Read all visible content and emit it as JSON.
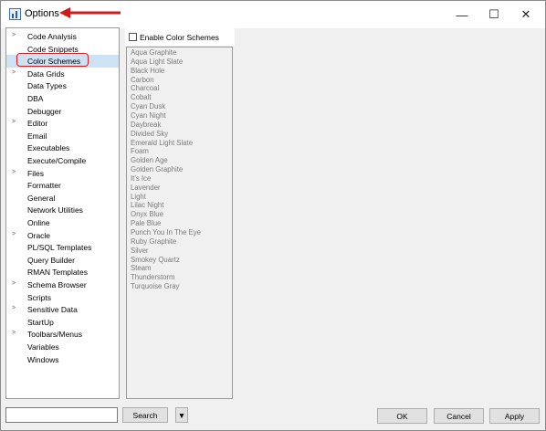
{
  "window": {
    "title": "Options",
    "minimize_glyph": "—",
    "maximize_glyph": "☐",
    "close_glyph": "✕",
    "annotation_color": "#d11a1a"
  },
  "tree": {
    "selected": "Color Schemes",
    "items": [
      {
        "label": "Code Analysis",
        "expandable": true
      },
      {
        "label": "Code Snippets",
        "expandable": false
      },
      {
        "label": "Color Schemes",
        "expandable": false
      },
      {
        "label": "Data Grids",
        "expandable": true
      },
      {
        "label": "Data Types",
        "expandable": false
      },
      {
        "label": "DBA",
        "expandable": false
      },
      {
        "label": "Debugger",
        "expandable": false
      },
      {
        "label": "Editor",
        "expandable": true
      },
      {
        "label": "Email",
        "expandable": false
      },
      {
        "label": "Executables",
        "expandable": false
      },
      {
        "label": "Execute/Compile",
        "expandable": false
      },
      {
        "label": "Files",
        "expandable": true
      },
      {
        "label": "Formatter",
        "expandable": false
      },
      {
        "label": "General",
        "expandable": false
      },
      {
        "label": "Network Utilities",
        "expandable": false
      },
      {
        "label": "Online",
        "expandable": false
      },
      {
        "label": "Oracle",
        "expandable": true
      },
      {
        "label": "PL/SQL Templates",
        "expandable": false
      },
      {
        "label": "Query Builder",
        "expandable": false
      },
      {
        "label": "RMAN Templates",
        "expandable": false
      },
      {
        "label": "Schema Browser",
        "expandable": true
      },
      {
        "label": "Scripts",
        "expandable": false
      },
      {
        "label": "Sensitive Data",
        "expandable": true
      },
      {
        "label": "StartUp",
        "expandable": false
      },
      {
        "label": "Toolbars/Menus",
        "expandable": true
      },
      {
        "label": "Variables",
        "expandable": false
      },
      {
        "label": "Windows",
        "expandable": false
      }
    ]
  },
  "color_schemes": {
    "enable_label": "Enable Color Schemes",
    "enabled": false,
    "schemes": [
      "Aqua Graphite",
      "Aqua Light Slate",
      "Black Hole",
      "Carbon",
      "Charcoal",
      "Cobalt",
      "Cyan Dusk",
      "Cyan Night",
      "Daybreak",
      "Divided Sky",
      "Emerald Light Slate",
      "Foam",
      "Golden Age",
      "Golden Graphite",
      "It's Ice",
      "Lavender",
      "Light",
      "Lilac Night",
      "Onyx Blue",
      "Pale Blue",
      "Punch You In The Eye",
      "Ruby Graphite",
      "Silver",
      "Smokey Quartz",
      "Steam",
      "Thunderstorm",
      "Turquoise Gray"
    ]
  },
  "footer": {
    "search_value": "",
    "search_label": "Search",
    "dropdown_glyph": "▼",
    "ok_label": "OK",
    "cancel_label": "Cancel",
    "apply_label": "Apply"
  }
}
